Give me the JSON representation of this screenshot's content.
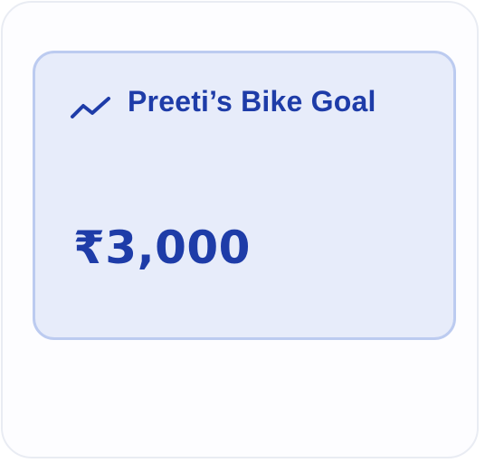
{
  "goal": {
    "title": "Preeti’s Bike Goal",
    "amount": "₹3,000",
    "icon": "trend-up-icon"
  },
  "colors": {
    "accent": "#1e3ca8",
    "card_bg": "#e7ecfa",
    "card_border": "#bccbf0",
    "outer_border": "#e9ecf3"
  }
}
